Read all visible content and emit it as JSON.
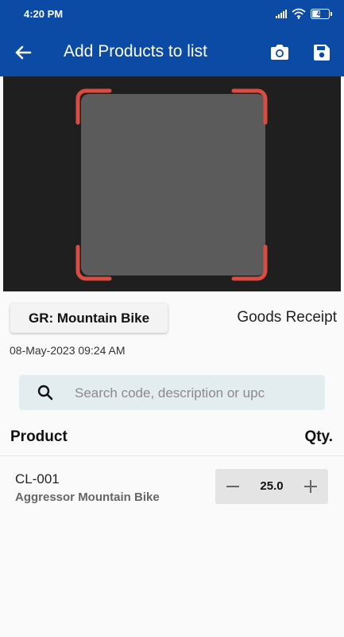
{
  "status_bar": {
    "time": "4:20 PM",
    "battery": "49",
    "battery_level_percent": 49,
    "icons": [
      "signal-icon",
      "wifi-icon",
      "battery-icon"
    ]
  },
  "app_bar": {
    "title": "Add Products to list",
    "icons": [
      "back-arrow-icon",
      "camera-icon",
      "save-icon"
    ],
    "color": "#0b4aa5"
  },
  "document": {
    "name": "GR: Mountain Bike",
    "type": "Goods Receipt",
    "date": "08-May-2023 09:24 AM"
  },
  "search": {
    "placeholder": "Search code, description or upc",
    "value": ""
  },
  "table": {
    "headers": {
      "product": "Product",
      "qty": "Qty."
    },
    "rows": [
      {
        "code": "CL-001",
        "description": "Aggressor Mountain Bike",
        "qty": "25.0"
      }
    ]
  },
  "colors": {
    "accent": "#0b4aa5",
    "scan_frame": "#d94c3f",
    "search_bg": "#e3edf0"
  }
}
